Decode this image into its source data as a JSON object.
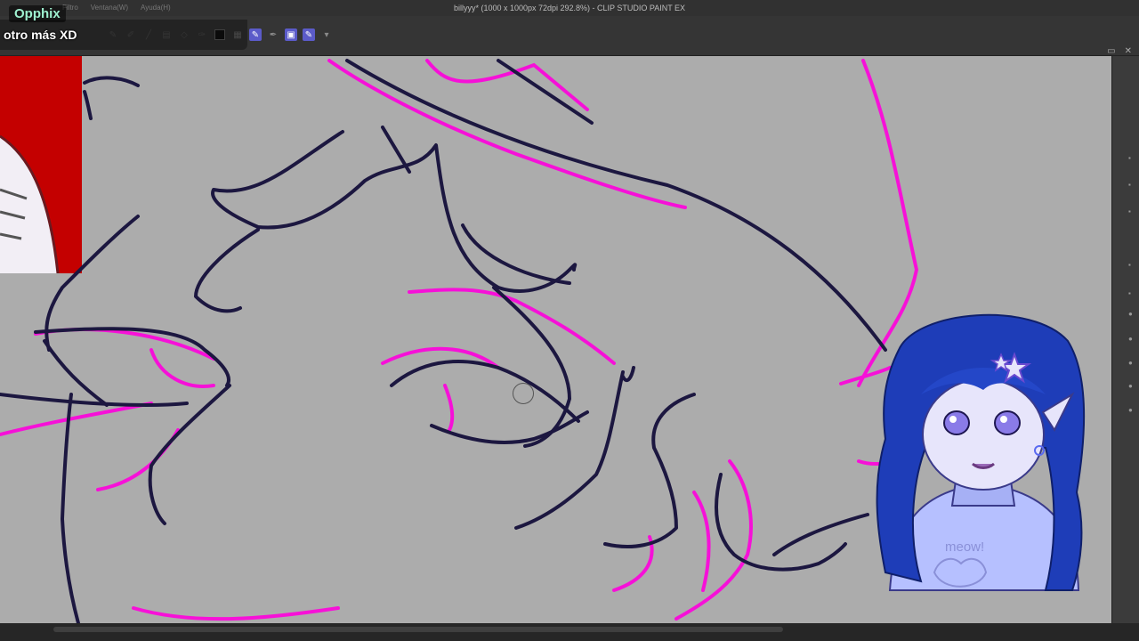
{
  "window": {
    "title": "billyyy* (1000 x 1000px 72dpi 292.8%) - CLIP STUDIO PAINT EX",
    "menu_items": [
      "Filtro",
      "Ventana(W)",
      "Ayuda(H)"
    ]
  },
  "chat": {
    "username": "Opphix",
    "message": "otro más XD",
    "username_color": "#9ef0cf"
  },
  "toolbar": {
    "icons": [
      "pen-icon",
      "pen-alt-icon",
      "line-icon",
      "ruler-icon",
      "eraser-icon",
      "brush-icon",
      "color-swatch",
      "transparent-toggle-icon",
      "pen-tool-icon",
      "selection-icon",
      "pressure-icon"
    ],
    "active_color": "#000000",
    "accent": "#5b5bc9"
  },
  "canvas": {
    "background": "#acacac",
    "line_color": "#1c1740",
    "sketch_color": "#ff00dd"
  },
  "avatar": {
    "sweater_text": "meow!",
    "hair_color": "#1e3db8",
    "sweater_color": "#b6c0ff"
  }
}
